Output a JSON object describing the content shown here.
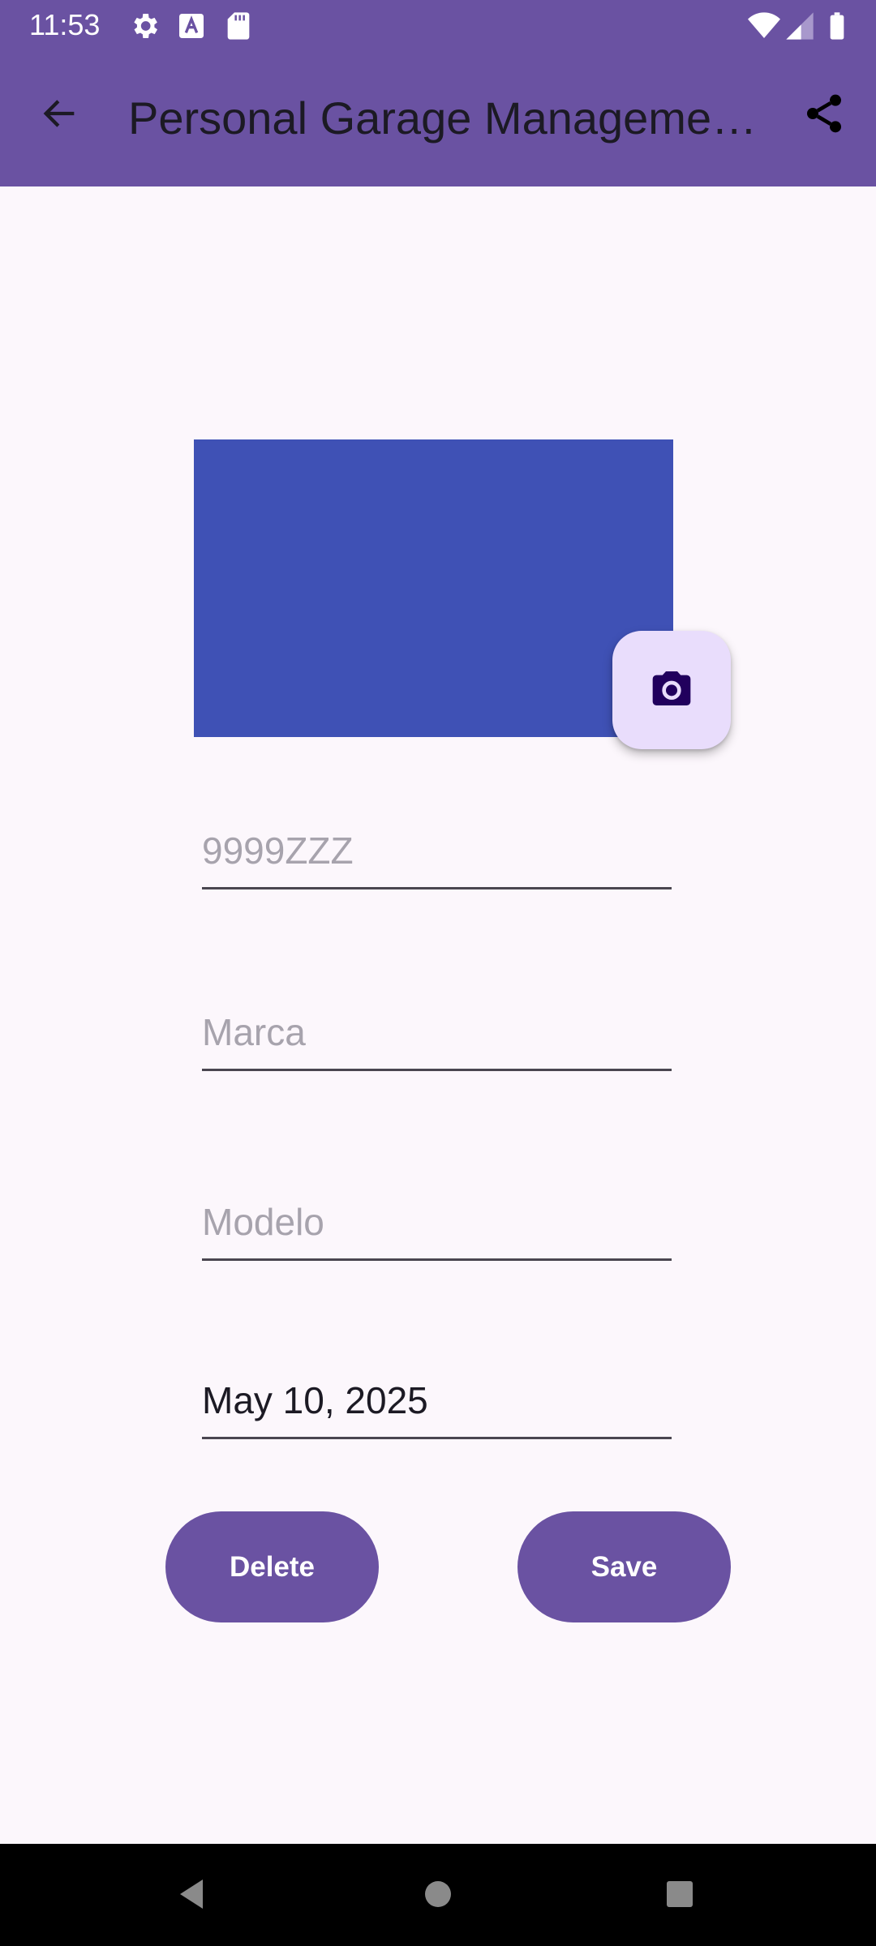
{
  "status_bar": {
    "time": "11:53",
    "icons": [
      "settings-icon",
      "text-a-icon",
      "sd-card-icon",
      "wifi-icon",
      "cellular-signal-icon",
      "battery-icon"
    ]
  },
  "app_bar": {
    "title": "Personal Garage Manageme…",
    "back_icon": "arrow-back-icon",
    "share_icon": "share-icon",
    "background_color": "#6a52a2"
  },
  "vehicle_image": {
    "color": "#3f51b5",
    "camera_icon": "camera-icon"
  },
  "form": {
    "plate": {
      "value": "",
      "placeholder": "9999ZZZ"
    },
    "brand": {
      "value": "",
      "placeholder": "Marca"
    },
    "model": {
      "value": "",
      "placeholder": "Modelo"
    },
    "date": {
      "value": "May 10, 2025"
    }
  },
  "actions": {
    "delete_label": "Delete",
    "save_label": "Save",
    "button_color": "#6a52a2"
  },
  "nav_bar": {
    "icons": [
      "nav-back-icon",
      "nav-home-icon",
      "nav-recents-icon"
    ]
  }
}
